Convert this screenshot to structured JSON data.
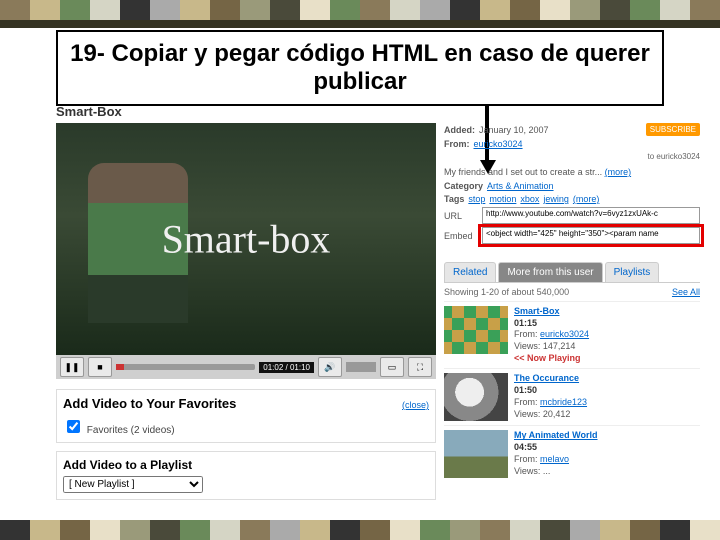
{
  "title": "19- Copiar y pegar código HTML en caso de querer publicar",
  "section_title": "Smart-Box",
  "video_overlay": "Smart-box",
  "controls": {
    "time": "01:02 / 01:10"
  },
  "meta": {
    "added_label": "Added:",
    "added_value": "January 10, 2007",
    "from_label": "From:",
    "from_user": "euricko3024",
    "subscribe": "SUBSCRIBE",
    "subscribe_to": "to euricko3024",
    "description": "My friends and I set out to create a str...",
    "more": "(more)",
    "category_label": "Category",
    "category_value": "Arts & Animation",
    "tags_label": "Tags",
    "tags": [
      "stop",
      "motion",
      "xbox",
      "jewing"
    ],
    "tags_more": "(more)",
    "url_label": "URL",
    "url_value": "http://www.youtube.com/watch?v=6vyz1zxUAk-c",
    "embed_label": "Embed",
    "embed_value": "<object width=\"425\" height=\"350\"><param name"
  },
  "tabs": [
    "Related",
    "More from this user",
    "Playlists"
  ],
  "related": {
    "showing": "Showing 1-20 of about 540,000",
    "see_all": "See All",
    "items": [
      {
        "title": "Smart-Box",
        "dur": "01:15",
        "from": "euricko3024",
        "views": "147,214",
        "now": "<< Now Playing",
        "thumb": "th1"
      },
      {
        "title": "The Occurance",
        "dur": "01:50",
        "from": "mcbride123",
        "views": "20,412",
        "thumb": "th2"
      },
      {
        "title": "My Animated World",
        "dur": "04:55",
        "from": "melavo",
        "views": "...",
        "thumb": "th3"
      }
    ]
  },
  "favorites": {
    "title": "Add Video to Your Favorites",
    "close": "(close)",
    "checkbox_label": "Favorites (2 videos)"
  },
  "playlist": {
    "title": "Add Video to a Playlist",
    "selected": "[ New Playlist ]"
  }
}
